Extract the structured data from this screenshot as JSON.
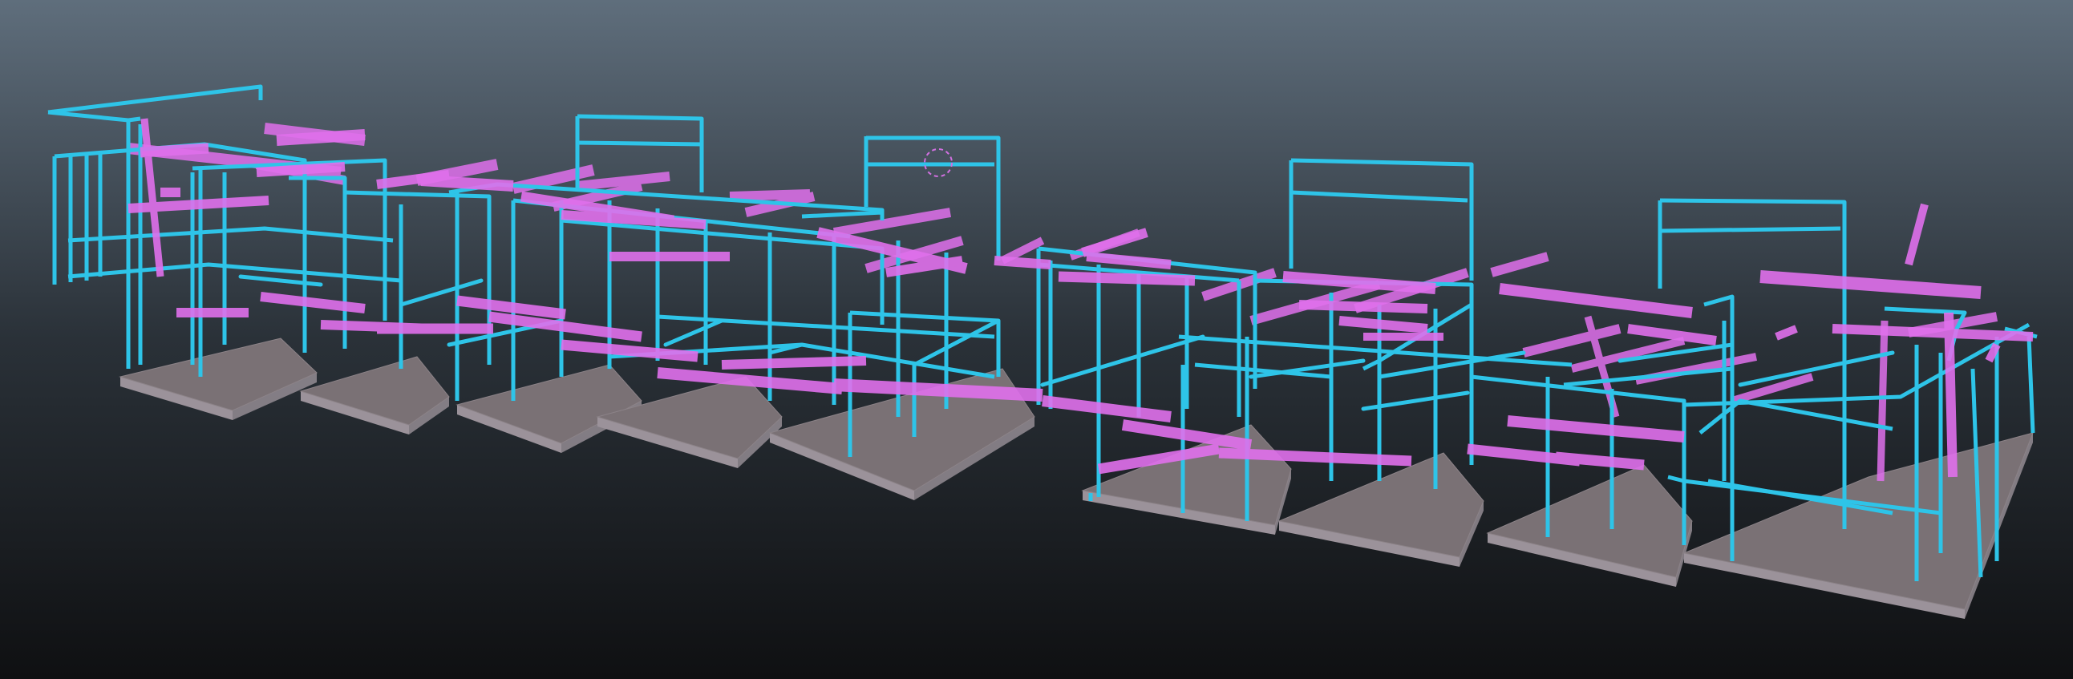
{
  "viewport": {
    "mode": "3d-structural-model-view",
    "background": {
      "top": "#5f6e7c",
      "mid": "#2a3138",
      "bottom": "#0f1012"
    },
    "colors": {
      "column": "#2ec4e8",
      "beam": "#e070ec",
      "slab_top": "#7a7175",
      "slab_side": "#9b929a",
      "selection": "#d070e0"
    },
    "model": {
      "slab_count": 9,
      "element_types": [
        "column",
        "beam",
        "brace",
        "slab",
        "frame"
      ]
    }
  }
}
